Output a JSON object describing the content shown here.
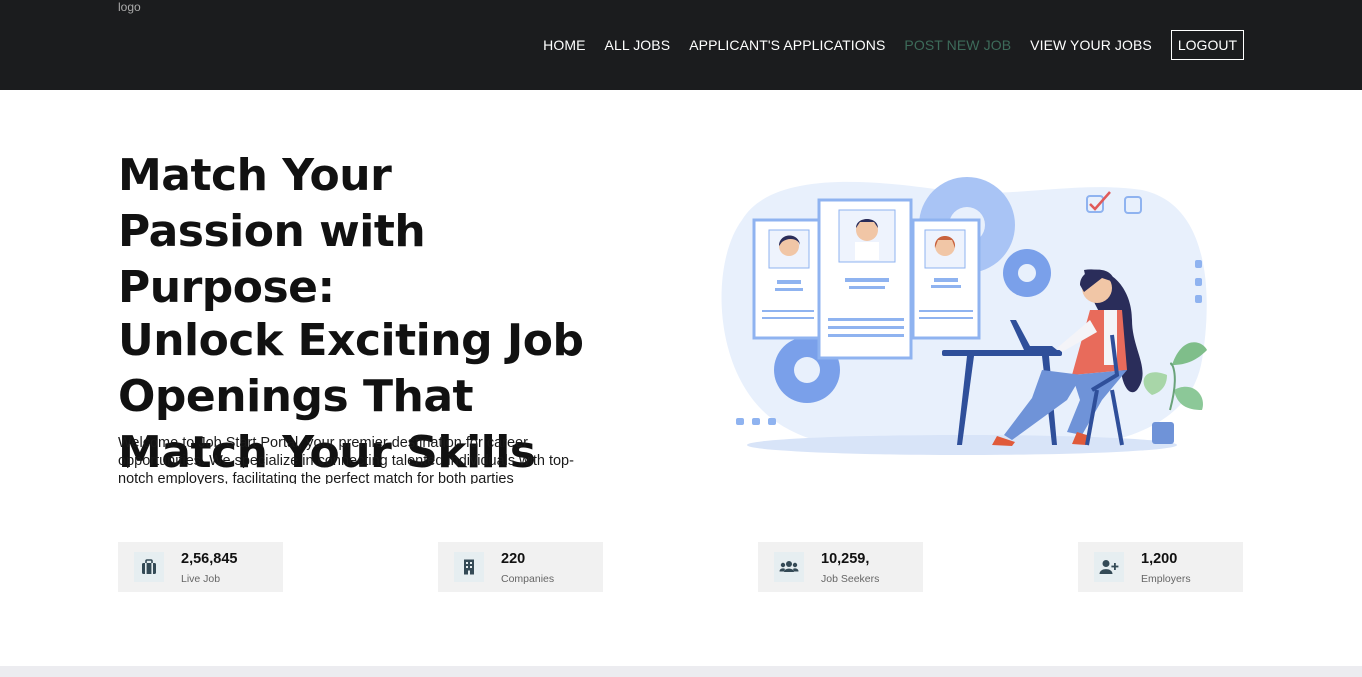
{
  "header": {
    "logo_alt": "logo",
    "nav": [
      {
        "label": "HOME"
      },
      {
        "label": "ALL JOBS"
      },
      {
        "label": "APPLICANT'S APPLICATIONS"
      },
      {
        "label": "POST NEW JOB"
      },
      {
        "label": "VIEW YOUR JOBS"
      }
    ],
    "logout_label": "LOGOUT",
    "active_color": "#3d6b5a"
  },
  "hero": {
    "title_line1": "Match Your Passion with Purpose:",
    "title_line2": "Unlock Exciting Job Openings That Match Your Skills",
    "description": "Welcome to Job Start Portal, your premier destination for career opportunities. We specialize in connecting talented individuals with top-notch employers, facilitating the perfect match for both parties"
  },
  "stats": [
    {
      "value": "2,56,845",
      "label": "Live Job",
      "icon": "briefcase-icon"
    },
    {
      "value": "220",
      "label": "Companies",
      "icon": "building-icon"
    },
    {
      "value": "10,259,",
      "label": "Job Seekers",
      "icon": "users-icon"
    },
    {
      "value": "1,200",
      "label": "Employers",
      "icon": "user-plus-icon"
    }
  ],
  "colors": {
    "nav_bg": "#1b1c1e",
    "accent_blue": "#8fb3f0",
    "icon_color": "#344a56"
  }
}
